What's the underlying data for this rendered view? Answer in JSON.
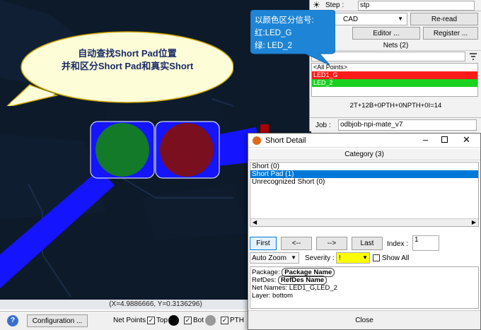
{
  "callout_left": {
    "line1": "自动查找Short Pad位置",
    "line2": "并和区分Short Pad和真实Short"
  },
  "callout_right": {
    "line1": "以颜色区分信号:",
    "line2": "红:LED_G",
    "line3": "绿: LED_2"
  },
  "coords": "(X=4.9886666, Y=0.3136296)",
  "bottom": {
    "config_label": "Configuration ...",
    "net_points_label": "Net Points :",
    "top_label": "Top",
    "bot_label": "Bot",
    "pth_label": "PTH",
    "top_checked": true,
    "bot_checked": true,
    "pth_checked": true
  },
  "right_panel": {
    "step_label": "Step :",
    "step_value": "stp",
    "cad_value": "CAD",
    "reread_label": "Re-read",
    "editor_label": "Editor ...",
    "register_label": "Register ...",
    "nets_header": "Nets (2)",
    "all_points_label": "<All Points>",
    "nets": [
      {
        "name": "LED1_G",
        "color": "#ff1a1a"
      },
      {
        "name": "LED_2",
        "color": "#19d11f"
      }
    ],
    "summary": "2T+12B+0PTH+0NPTH+0I=14",
    "job_label": "Job :",
    "job_value": "odbjob-npi-mate_v7"
  },
  "dialog": {
    "title": "Short Detail",
    "category_header": "Category (3)",
    "categories": [
      "Short (0)",
      "Short Pad (1)",
      "Unrecognized Short (0)"
    ],
    "selected_category": "Short Pad (1)",
    "nav": {
      "first": "First",
      "prev": "<--",
      "next": "-->",
      "last": "Last"
    },
    "index_label": "Index :",
    "index_value": "1",
    "zoom_value": "Auto Zoom",
    "severity_label": "Severity :",
    "severity_value": "!",
    "show_all_label": "Show All",
    "details": {
      "package_label": "Package:",
      "package_value": "Package Name",
      "refdes_label": "RefDes:",
      "refdes_value": "RefDes Name",
      "netnames_label": "Net Names:",
      "netnames_value": "LED1_G,LED_2",
      "layer_label": "Layer:",
      "layer_value": "bottom"
    },
    "close_label": "Close"
  },
  "colors": {
    "board_bg": "#0c1a2a",
    "trace_blue": "#1414ff",
    "pad_green": "#137a2a",
    "pad_red": "#7a0f1f",
    "selection": "#0078d7",
    "severity_yellow": "#ffff00",
    "callout_fill": "#fdfdd8"
  }
}
